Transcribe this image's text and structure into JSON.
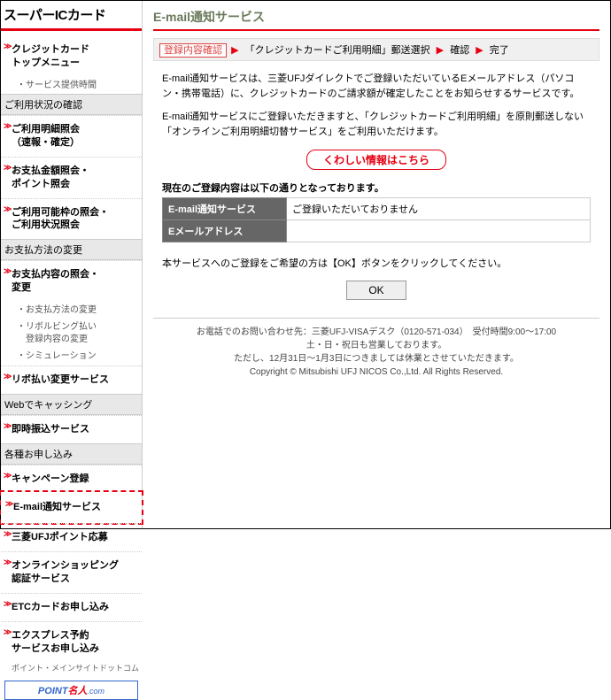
{
  "sidebar": {
    "title": "スーパーICカード",
    "groups": [
      {
        "items": [
          {
            "label": "クレジットカード\nトップメニュー",
            "sub": "・サービス提供時間"
          }
        ]
      },
      {
        "heading": "ご利用状況の確認",
        "items": [
          {
            "label": "ご利用明細照会\n（速報・確定）"
          },
          {
            "label": "お支払金額照会・\nポイント照会"
          },
          {
            "label": "ご利用可能枠の照会・\nご利用状況照会"
          }
        ]
      },
      {
        "heading": "お支払方法の変更",
        "items": [
          {
            "label": "お支払内容の照会・\n変更",
            "subs": [
              "・お支払方法の変更",
              "・リボルビング払い\n　登録内容の変更",
              "・シミュレーション"
            ]
          },
          {
            "label": "リボ払い変更サービス"
          }
        ]
      },
      {
        "heading": "Webでキャッシング",
        "items": [
          {
            "label": "即時振込サービス"
          }
        ]
      },
      {
        "heading": "各種お申し込み",
        "items": [
          {
            "label": "キャンペーン登録"
          },
          {
            "label": "E-mail通知サービス",
            "highlight": true
          },
          {
            "label": "三菱UFJポイント応募"
          },
          {
            "label": "オンラインショッピング\n認証サービス"
          },
          {
            "label": "ETCカードお申し込み"
          },
          {
            "label": "エクスプレス予約\nサービスお申し込み"
          }
        ]
      }
    ],
    "banner": {
      "p1": "POINT",
      "p2": "名人",
      "p3": ".com"
    },
    "banner_caption": "ポイント・メインサイトドットコム"
  },
  "page": {
    "title": "E-mail通知サービス",
    "breadcrumb": {
      "current": "登録内容確認",
      "steps": [
        "「クレジットカードご利用明細」郵送選択",
        "確認",
        "完了"
      ]
    },
    "para1": "E-mail通知サービスは、三菱UFJダイレクトでご登録いただいているEメールアドレス（パソコン・携帯電話）に、クレジットカードのご請求額が確定したことをお知らせするサービスです。",
    "para2": "E-mail通知サービスにご登録いただきますと、「クレジットカードご利用明細」を原則郵送しない「オンラインご利用明細切替サービス」をご利用いただけます。",
    "info_link": "くわしい情報はこちら",
    "table_caption": "現在のご登録内容は以下の通りとなっております。",
    "rows": [
      {
        "th": "E-mail通知サービス",
        "td": "ご登録いただいておりません"
      },
      {
        "th": "Eメールアドレス",
        "td": ""
      }
    ],
    "para3": "本サービスへのご登録をご希望の方は【OK】ボタンをクリックしてください。",
    "ok": "OK",
    "footer": {
      "l1": "お電話でのお問い合わせ先：三菱UFJ-VISAデスク（0120-571-034）　受付時間9:00～17:00",
      "l2": "土・日・祝日も営業しております。",
      "l3": "ただし、12月31日～1月3日につきましては休業とさせていただきます。",
      "l4": "Copyright © Mitsubishi UFJ NICOS Co.,Ltd. All Rights Reserved."
    }
  }
}
